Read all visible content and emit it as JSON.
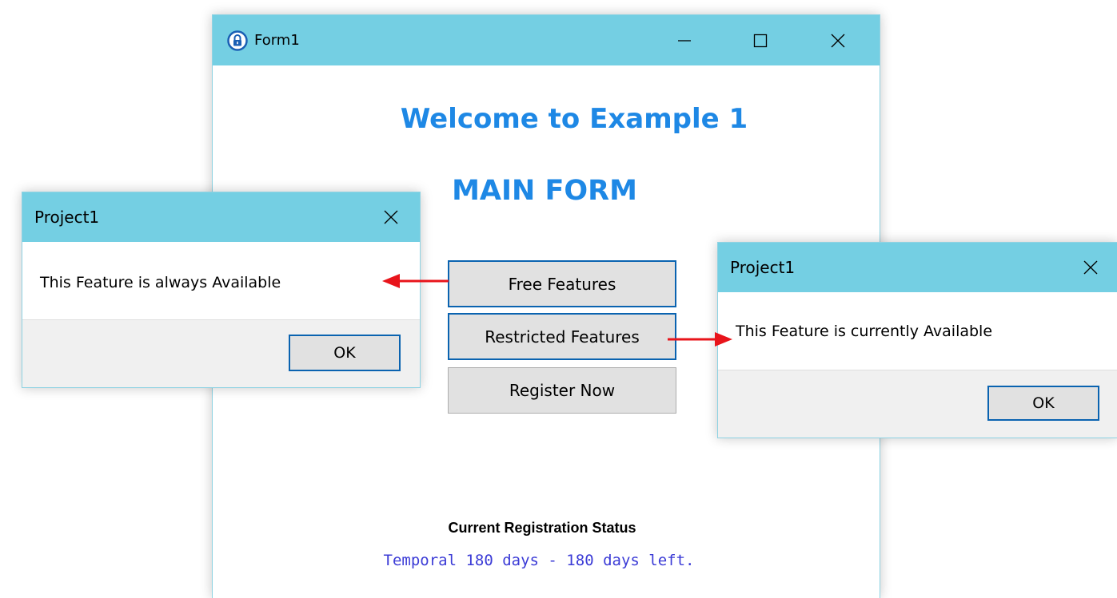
{
  "main_window": {
    "title": "Form1",
    "app_icon": "lock-icon",
    "controls": {
      "minimize": "—",
      "maximize": "☐",
      "close": "✕"
    },
    "heading": "Welcome to Example 1",
    "subheading": "MAIN FORM",
    "buttons": {
      "free": "Free Features",
      "restricted": "Restricted Features",
      "register": "Register Now"
    },
    "status_label": "Current Registration Status",
    "status_value": "Temporal 180 days - 180 days left."
  },
  "dialog_left": {
    "title": "Project1",
    "close": "✕",
    "message": "This Feature is always Available",
    "ok": "OK"
  },
  "dialog_right": {
    "title": "Project1",
    "close": "✕",
    "message": "This Feature is currently Available",
    "ok": "OK"
  },
  "colors": {
    "titlebar": "#74cfe3",
    "heading": "#1e88e5",
    "status_value": "#3b3bd6",
    "arrow": "#e8141b",
    "focus_border": "#0a63b0"
  }
}
